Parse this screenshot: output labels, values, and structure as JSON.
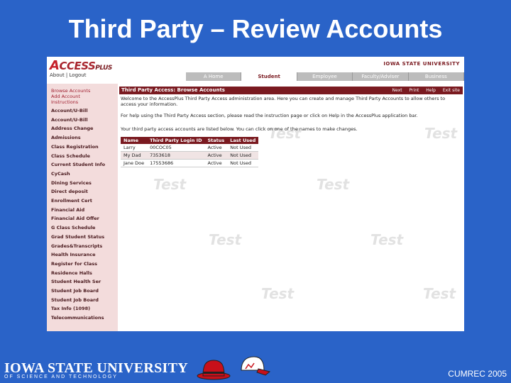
{
  "slide": {
    "title": "Third Party – Review Accounts",
    "footer_org": "IOWA STATE UNIVERSITY",
    "footer_sub": "OF SCIENCE AND TECHNOLOGY",
    "footer_right": "CUMREC 2005"
  },
  "app": {
    "logo_a": "A",
    "logo_text": "CCESS",
    "logo_plus": "PLUS",
    "about_links": "About | Logout",
    "university": "IOWA STATE UNIVERSITY",
    "tabs": [
      {
        "label": "A Home"
      },
      {
        "label": "Student"
      },
      {
        "label": "Employee"
      },
      {
        "label": "Faculty/Adviser"
      },
      {
        "label": "Business"
      }
    ],
    "active_tab": "Student"
  },
  "sidebar": {
    "sub_items": [
      "Browse Accounts",
      "Add Account",
      "Instructions"
    ],
    "items": [
      "Account/U-Bill",
      "Account/U-Bill",
      "Address Change",
      "Admissions",
      "Class Registration",
      "Class Schedule",
      "Current Student Info",
      "CyCash",
      "Dining Services",
      "Direct deposit",
      "Enrollment Cert",
      "Financial Aid",
      "Financial Aid Offer",
      "G Class Schedule",
      "Grad Student Status",
      "Grades&Transcripts",
      "Health Insurance",
      "Register for Class",
      "Residence Halls",
      "Student Health Ser",
      "Student Job Board",
      "Student Job Board",
      "Tax Info (1098)",
      "Telecommunications"
    ]
  },
  "main": {
    "header_title": "Third Party Access: Browse Accounts",
    "tools": [
      "Next",
      "Print",
      "Help",
      "Exit site"
    ],
    "welcome": "Welcome to the AccessPlus Third Party Access administration area. Here you can create and manage Third Party Accounts to allow others to access your information.",
    "help": "For help using the Third Party Access section, please read the instruction page or click on Help in the AccessPlus application bar.",
    "listed": "Your third party access accounts are listed below. You can click on one of the names to make changes.",
    "table": {
      "headers": [
        "Name",
        "Third Party Login ID",
        "Status",
        "Last Used"
      ],
      "rows": [
        [
          "Larry",
          "00COC05",
          "Active",
          "Not Used"
        ],
        [
          "My Dad",
          "7353618",
          "Active",
          "Not Used"
        ],
        [
          "Jane Doe",
          "17553686",
          "Active",
          "Not Used"
        ]
      ]
    },
    "watermark": "Test"
  }
}
